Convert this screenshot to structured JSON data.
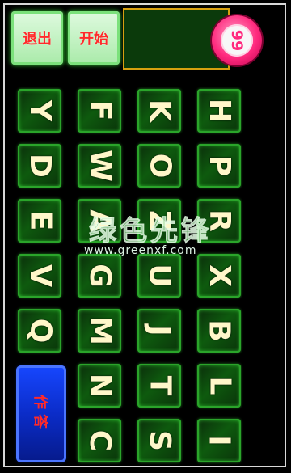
{
  "buttons": {
    "exit_label": "退出",
    "start_label": "开始",
    "answer_label": "作答"
  },
  "timer": {
    "value": "99"
  },
  "letters": {
    "col1": [
      "Y",
      "D",
      "E",
      "V",
      "Q"
    ],
    "col2": [
      "F",
      "W",
      "A",
      "G",
      "M",
      "N",
      "C"
    ],
    "col3": [
      "K",
      "O",
      "Z",
      "U",
      "J",
      "T",
      "S"
    ],
    "col4": [
      "H",
      "P",
      "R",
      "X",
      "B",
      "L",
      "I"
    ]
  },
  "watermark": {
    "title": "绿色先锋",
    "url": "www.greenxf.com"
  },
  "colors": {
    "background": "#000000",
    "tile": "#0e5a0e",
    "tile_glow": "#46ff46",
    "letter": "#fff7c9",
    "timer": "#ff2a7e",
    "answer_button": "#0b2cc8"
  }
}
